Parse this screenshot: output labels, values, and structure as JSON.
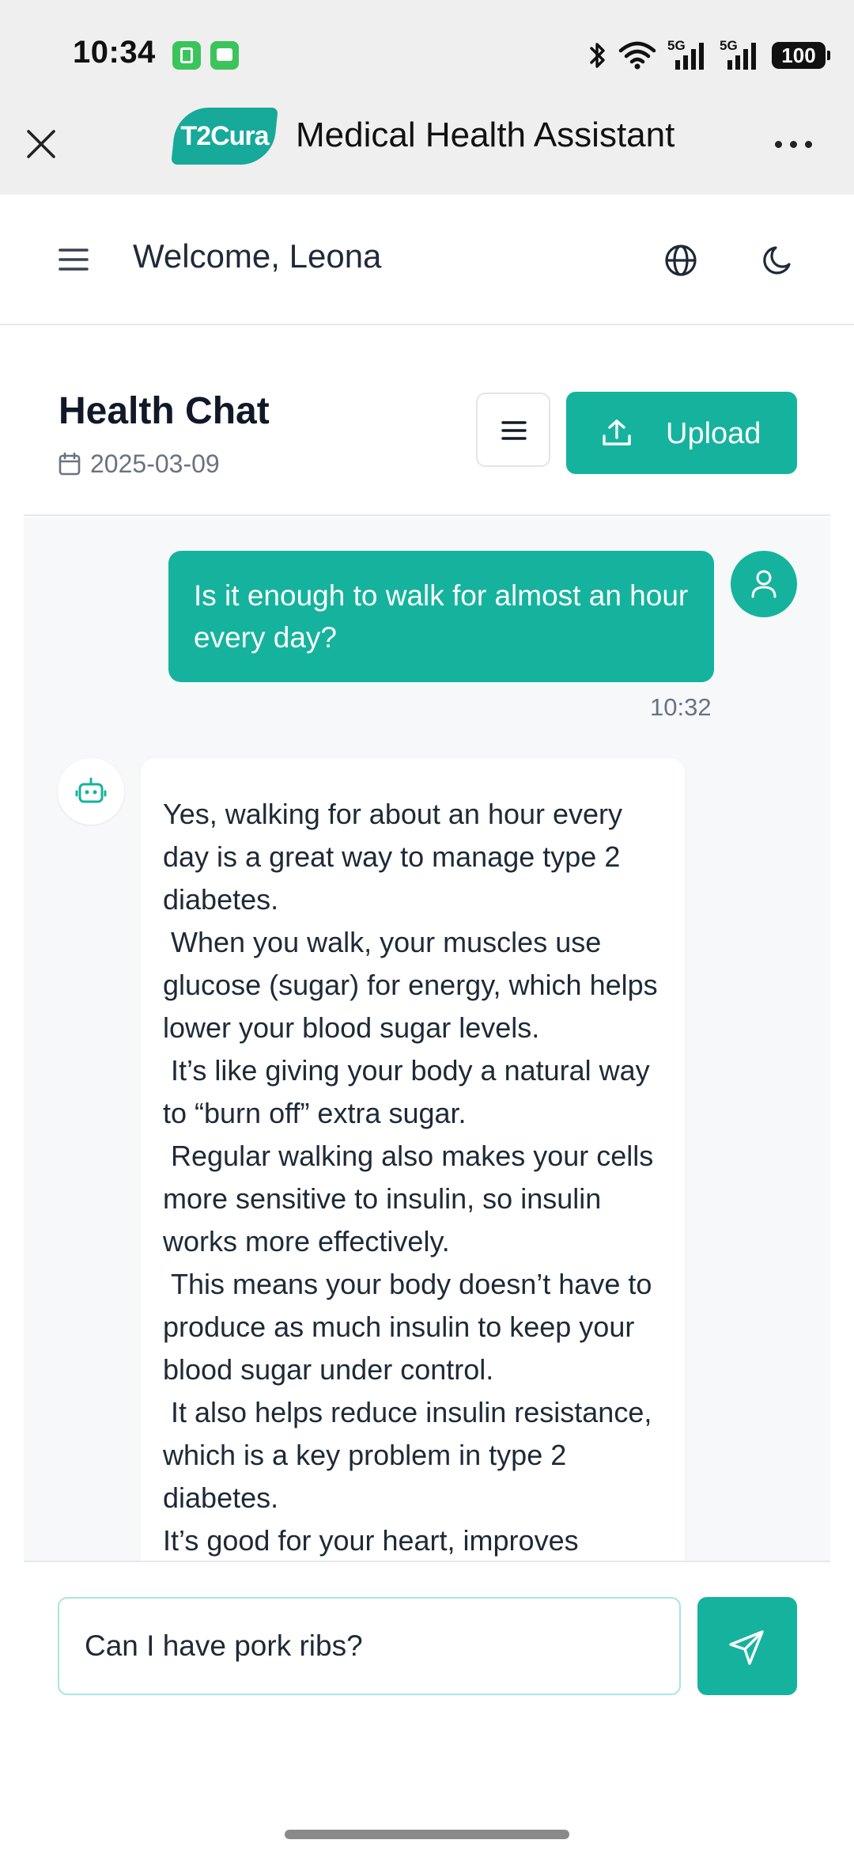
{
  "status_bar": {
    "time": "10:34",
    "battery": "100",
    "network_1": "5G",
    "network_2": "5G",
    "icons": [
      "battery-notification-icon",
      "message-notification-icon",
      "bluetooth-icon",
      "wifi-icon",
      "signal-5g-icon",
      "signal-5g-icon",
      "battery-icon"
    ]
  },
  "miniapp": {
    "close_icon": "close-icon",
    "logo_text": "T2Cura",
    "title": "Medical Health Assistant",
    "more_icon": "more-dots-icon"
  },
  "header": {
    "menu_icon": "hamburger-icon",
    "welcome": "Welcome, Leona",
    "language_icon": "globe-icon",
    "theme_icon": "moon-icon"
  },
  "chat": {
    "title": "Health Chat",
    "date": "2025-03-09",
    "date_icon": "calendar-icon",
    "menu_icon": "hamburger-icon",
    "upload_label": "Upload",
    "upload_icon": "upload-icon"
  },
  "messages": {
    "user_text": "Is it enough to walk for almost an hour every day?",
    "user_time": "10:32",
    "bot_text": "Yes, walking for about an hour every day is a great way to manage type 2 diabetes.\n When you walk, your muscles use glucose (sugar) for energy, which helps lower your blood sugar levels.\n It’s like giving your body a natural way to “burn off” extra sugar.\n Regular walking also makes your cells more sensitive to insulin, so insulin works more effectively.\n This means your body doesn’t have to produce as much insulin to keep your blood sugar under control.\n It also helps reduce insulin resistance, which is a key problem in type 2 diabetes.\nIt’s good for your heart, improves"
  },
  "composer": {
    "value": "Can I have pork ribs?",
    "send_icon": "send-icon"
  },
  "colors": {
    "accent": "#15b39d",
    "title_bar_bg": "#efefef",
    "chat_bg": "#f7f8fa"
  }
}
